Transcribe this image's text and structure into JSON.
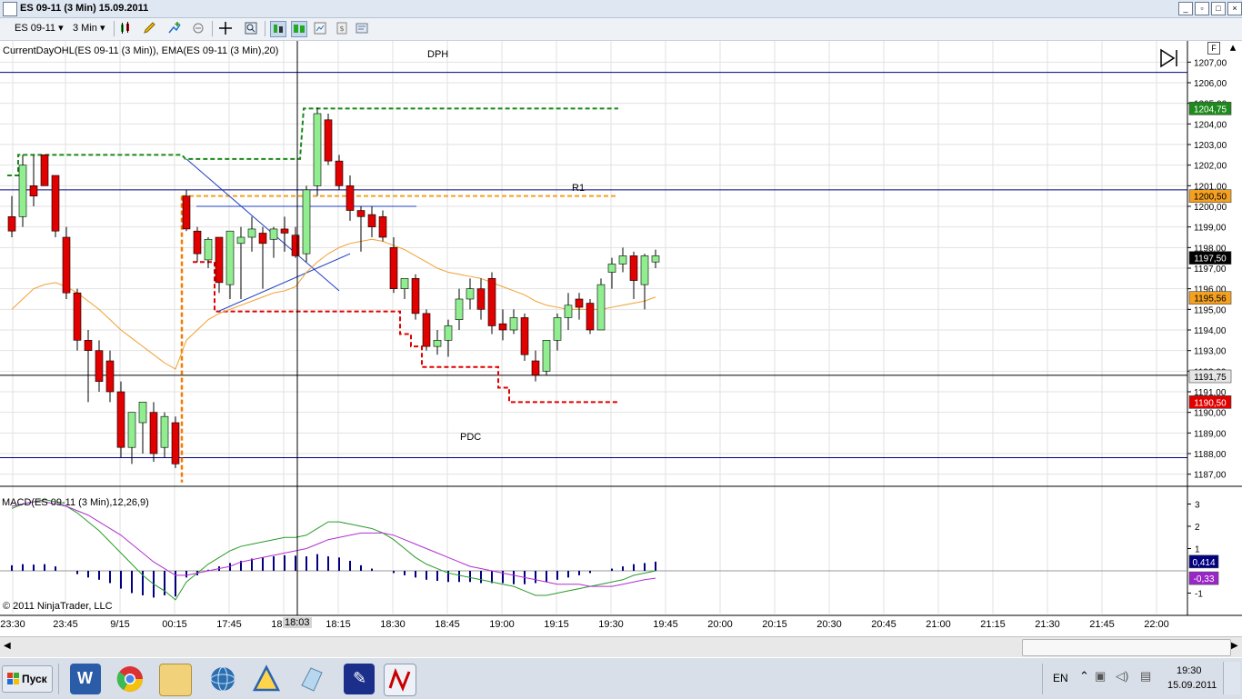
{
  "window": {
    "title": "ES 09-11 (3 Min)  15.09.2011"
  },
  "toolbar": {
    "instrument": "ES 09-11",
    "interval": "3 Min"
  },
  "price_panel": {
    "indicator_label": "CurrentDayOHL(ES 09-11 (3 Min)), EMA(ES 09-11 (3 Min),20)",
    "level_labels": {
      "dph": "DPH",
      "r1": "R1",
      "pdc": "PDC"
    },
    "axis_ticks": [
      "1207,00",
      "1206,00",
      "1205,00",
      "1204,00",
      "1203,00",
      "1202,00",
      "1201,00",
      "1200,00",
      "1199,00",
      "1198,00",
      "1197,00",
      "1196,00",
      "1195,00",
      "1194,00",
      "1193,00",
      "1192,00",
      "1191,00",
      "1190,00",
      "1189,00",
      "1188,00",
      "1187,00"
    ],
    "price_tags": [
      {
        "text": "1204,75",
        "bg": "#1e8a1e",
        "fg": "#ffffff",
        "price": 1204.75
      },
      {
        "text": "1200,50",
        "bg": "#f4a020",
        "fg": "#000000",
        "price": 1200.5
      },
      {
        "text": "1197,50",
        "bg": "#000000",
        "fg": "#ffffff",
        "price": 1197.5
      },
      {
        "text": "1195,56",
        "bg": "#f4a020",
        "fg": "#000000",
        "price": 1195.56
      },
      {
        "text": "1191,75",
        "bg": "#e6e6e6",
        "fg": "#000000",
        "price": 1191.75
      },
      {
        "text": "1190,50",
        "bg": "#e00000",
        "fg": "#ffffff",
        "price": 1190.5
      }
    ]
  },
  "macd_panel": {
    "indicator_label": "MACD(ES 09-11 (3 Min),12,26,9)",
    "axis_ticks": [
      "3",
      "2",
      "1",
      "-1"
    ],
    "value_tags": [
      {
        "text": "0,414",
        "bg": "#000080",
        "fg": "#ffffff",
        "value": 0.414
      },
      {
        "text": "-0,33",
        "bg": "#9a26c8",
        "fg": "#ffffff",
        "value": -0.33
      }
    ]
  },
  "time_axis": [
    "23:30",
    "23:45",
    "9/15",
    "00:15",
    "17:45",
    "18:00",
    "18:15",
    "18:30",
    "18:45",
    "19:00",
    "19:15",
    "19:30",
    "19:45",
    "20:00",
    "20:15",
    "20:30",
    "20:45",
    "21:00",
    "21:15",
    "21:30",
    "21:45",
    "22:00"
  ],
  "cursor_time": "18:03",
  "copyright": "© 2011 NinjaTrader, LLC",
  "taskbar": {
    "start_label": "Пуск",
    "lang": "EN",
    "time": "19:30",
    "date": "15.09.2011"
  },
  "chart_data": {
    "type": "candlestick",
    "title": "ES 09-11 (3 Min)",
    "ylim": [
      1186.5,
      1207.5
    ],
    "candles": [
      [
        1199.5,
        1200.5,
        1198.5,
        1198.8
      ],
      [
        1199.5,
        1202.5,
        1199.0,
        1202.0
      ],
      [
        1201.0,
        1202.5,
        1200.0,
        1200.5
      ],
      [
        1202.5,
        1202.5,
        1201.0,
        1201.0
      ],
      [
        1201.5,
        1201.5,
        1198.5,
        1198.8
      ],
      [
        1198.5,
        1199.0,
        1195.5,
        1195.8
      ],
      [
        1195.8,
        1196.0,
        1193.0,
        1193.5
      ],
      [
        1193.5,
        1194.0,
        1190.5,
        1193.0
      ],
      [
        1193.0,
        1193.5,
        1191.0,
        1191.5
      ],
      [
        1192.5,
        1193.0,
        1190.5,
        1191.0
      ],
      [
        1191.0,
        1191.5,
        1187.8,
        1188.3
      ],
      [
        1188.3,
        1190.0,
        1187.5,
        1190.0
      ],
      [
        1189.5,
        1190.5,
        1188.0,
        1190.5
      ],
      [
        1190.0,
        1190.5,
        1187.6,
        1188.0
      ],
      [
        1188.3,
        1190.0,
        1187.8,
        1189.8
      ],
      [
        1189.5,
        1189.8,
        1187.3,
        1187.5
      ],
      [
        1200.5,
        1200.8,
        1198.8,
        1198.9
      ],
      [
        1198.8,
        1199.0,
        1197.3,
        1197.7
      ],
      [
        1197.4,
        1198.5,
        1197.0,
        1198.4
      ],
      [
        1198.5,
        1198.5,
        1195.8,
        1196.3
      ],
      [
        1196.2,
        1198.8,
        1195.5,
        1198.8
      ],
      [
        1198.2,
        1199.0,
        1195.5,
        1198.5
      ],
      [
        1198.5,
        1199.5,
        1197.8,
        1198.9
      ],
      [
        1198.7,
        1199.0,
        1196.0,
        1198.2
      ],
      [
        1198.4,
        1199.0,
        1197.5,
        1198.9
      ],
      [
        1198.9,
        1199.5,
        1197.8,
        1198.7
      ],
      [
        1198.6,
        1199.0,
        1197.5,
        1197.6
      ],
      [
        1197.7,
        1201.0,
        1197.3,
        1200.8
      ],
      [
        1201.0,
        1204.8,
        1200.5,
        1204.5
      ],
      [
        1204.2,
        1204.5,
        1202.0,
        1202.2
      ],
      [
        1202.2,
        1202.5,
        1200.8,
        1201.0
      ],
      [
        1201.0,
        1201.5,
        1199.3,
        1199.8
      ],
      [
        1199.8,
        1200.0,
        1197.8,
        1199.5
      ],
      [
        1199.6,
        1200.0,
        1198.5,
        1199.0
      ],
      [
        1199.5,
        1199.8,
        1198.3,
        1198.5
      ],
      [
        1198.0,
        1198.5,
        1195.8,
        1196.0
      ],
      [
        1196.0,
        1196.5,
        1195.5,
        1196.5
      ],
      [
        1196.5,
        1196.7,
        1194.5,
        1194.8
      ],
      [
        1194.8,
        1195.0,
        1193.0,
        1193.2
      ],
      [
        1193.2,
        1194.0,
        1192.8,
        1193.5
      ],
      [
        1193.5,
        1194.5,
        1192.7,
        1194.2
      ],
      [
        1194.5,
        1196.0,
        1194.0,
        1195.5
      ],
      [
        1195.5,
        1196.5,
        1195.0,
        1196.0
      ],
      [
        1196.0,
        1196.5,
        1194.5,
        1195.0
      ],
      [
        1196.5,
        1196.8,
        1193.8,
        1194.2
      ],
      [
        1194.3,
        1195.0,
        1193.5,
        1194.0
      ],
      [
        1194.0,
        1195.0,
        1193.8,
        1194.6
      ],
      [
        1194.6,
        1194.8,
        1192.5,
        1192.8
      ],
      [
        1192.5,
        1193.0,
        1191.5,
        1191.8
      ],
      [
        1192.0,
        1193.5,
        1191.8,
        1193.5
      ],
      [
        1193.5,
        1194.8,
        1193.0,
        1194.6
      ],
      [
        1194.6,
        1195.8,
        1194.0,
        1195.2
      ],
      [
        1195.5,
        1195.8,
        1194.5,
        1195.1
      ],
      [
        1195.3,
        1195.5,
        1193.8,
        1194.0
      ],
      [
        1194.0,
        1196.5,
        1194.0,
        1196.2
      ],
      [
        1196.8,
        1197.5,
        1196.0,
        1197.2
      ],
      [
        1197.2,
        1198.0,
        1196.8,
        1197.6
      ],
      [
        1197.6,
        1197.8,
        1195.5,
        1196.4
      ],
      [
        1196.2,
        1197.7,
        1195.0,
        1197.6
      ],
      [
        1197.3,
        1197.9,
        1197.0,
        1197.6
      ]
    ],
    "ema": [
      1195.0,
      1195.5,
      1196.0,
      1196.2,
      1196.3,
      1196.1,
      1195.8,
      1195.4,
      1195.0,
      1194.5,
      1194.0,
      1193.6,
      1193.2,
      1192.8,
      1192.4,
      1192.1,
      1193.5,
      1194.0,
      1194.5,
      1194.8,
      1195.0,
      1195.2,
      1195.4,
      1195.6,
      1195.8,
      1195.9,
      1196.1,
      1196.8,
      1197.3,
      1197.7,
      1198.0,
      1198.2,
      1198.3,
      1198.4,
      1198.3,
      1198.1,
      1197.9,
      1197.6,
      1197.3,
      1197.0,
      1196.8,
      1196.7,
      1196.6,
      1196.5,
      1196.3,
      1196.1,
      1195.9,
      1195.7,
      1195.4,
      1195.2,
      1195.1,
      1195.0,
      1195.0,
      1195.0,
      1195.0,
      1195.1,
      1195.2,
      1195.3,
      1195.4,
      1195.6
    ],
    "levels": {
      "dph": 1206.5,
      "r1": 1200.8,
      "pdc": 1187.8,
      "horizontal_line": 1191.8
    },
    "macd": {
      "histogram": [
        0.25,
        0.3,
        0.28,
        0.3,
        0.2,
        0.0,
        -0.15,
        -0.3,
        -0.4,
        -0.55,
        -0.8,
        -1.0,
        -1.1,
        -1.2,
        -1.1,
        -1.15,
        -0.3,
        -0.2,
        0.05,
        0.2,
        0.35,
        0.45,
        0.55,
        0.6,
        0.65,
        0.7,
        0.68,
        0.65,
        0.75,
        0.65,
        0.6,
        0.45,
        0.25,
        0.1,
        0.0,
        -0.1,
        -0.2,
        -0.3,
        -0.4,
        -0.45,
        -0.5,
        -0.5,
        -0.5,
        -0.55,
        -0.55,
        -0.55,
        -0.6,
        -0.6,
        -0.55,
        -0.5,
        -0.4,
        -0.3,
        -0.2,
        -0.1,
        0.0,
        0.1,
        0.2,
        0.3,
        0.35,
        0.414
      ],
      "macd_line": [
        2.8,
        3.0,
        3.1,
        3.2,
        3.1,
        2.9,
        2.6,
        2.2,
        1.8,
        1.3,
        0.8,
        0.3,
        -0.2,
        -0.6,
        -0.9,
        -1.3,
        -0.5,
        -0.1,
        0.3,
        0.6,
        0.9,
        1.1,
        1.2,
        1.3,
        1.4,
        1.5,
        1.5,
        1.6,
        1.9,
        2.2,
        2.2,
        2.1,
        2.0,
        1.9,
        1.7,
        1.4,
        1.0,
        0.6,
        0.3,
        0.1,
        -0.1,
        -0.2,
        -0.3,
        -0.4,
        -0.5,
        -0.6,
        -0.7,
        -0.9,
        -1.1,
        -1.1,
        -1.0,
        -0.9,
        -0.8,
        -0.7,
        -0.6,
        -0.5,
        -0.4,
        -0.2,
        -0.1,
        0.0
      ],
      "signal_line": [
        2.9,
        3.0,
        3.1,
        3.1,
        3.0,
        2.9,
        2.7,
        2.5,
        2.2,
        1.9,
        1.6,
        1.2,
        0.8,
        0.4,
        0.1,
        -0.2,
        -0.2,
        -0.1,
        0.0,
        0.1,
        0.2,
        0.4,
        0.5,
        0.6,
        0.7,
        0.8,
        0.9,
        1.0,
        1.2,
        1.4,
        1.5,
        1.6,
        1.7,
        1.7,
        1.7,
        1.6,
        1.4,
        1.2,
        1.0,
        0.8,
        0.6,
        0.4,
        0.2,
        0.1,
        0.0,
        -0.1,
        -0.2,
        -0.3,
        -0.4,
        -0.5,
        -0.6,
        -0.6,
        -0.6,
        -0.7,
        -0.7,
        -0.7,
        -0.6,
        -0.5,
        -0.4,
        -0.33
      ]
    }
  }
}
